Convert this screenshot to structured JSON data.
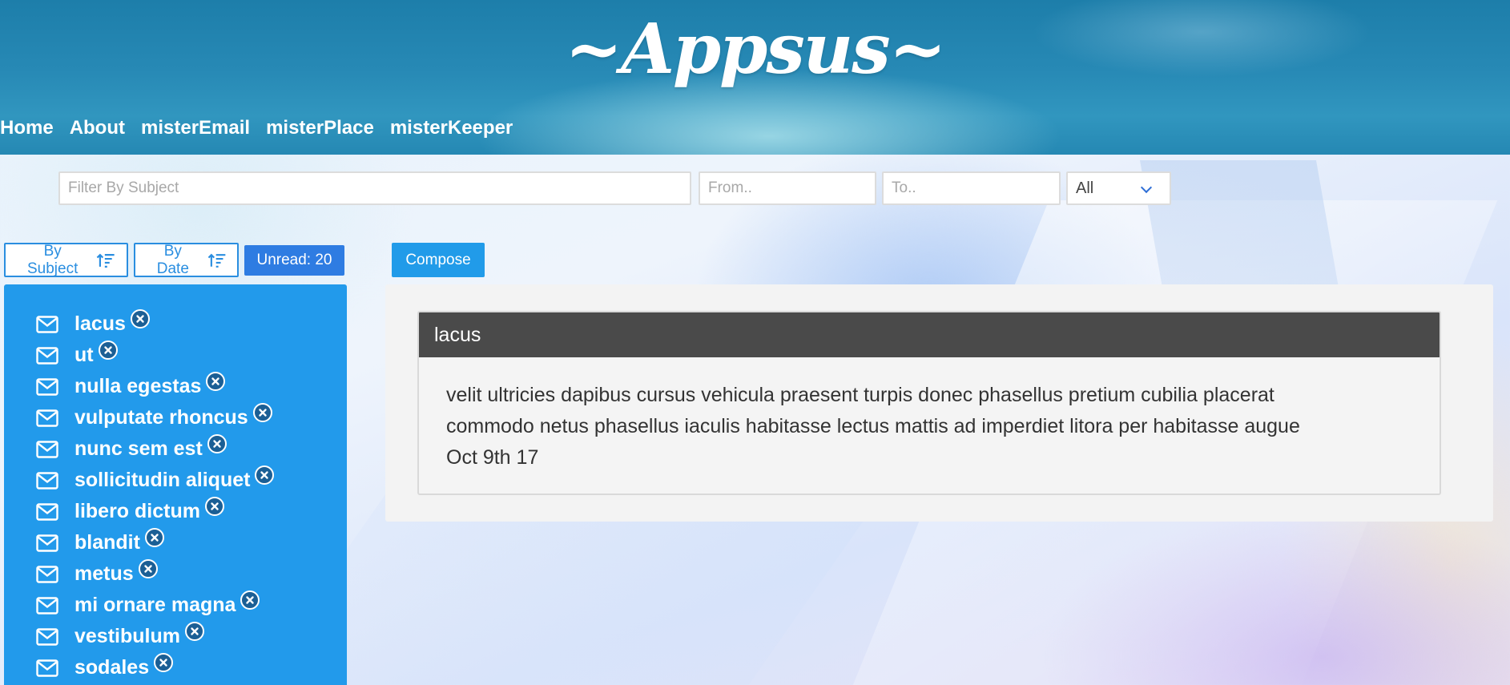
{
  "header": {
    "logo_text": "~Appsus~",
    "nav": [
      {
        "label": "Home"
      },
      {
        "label": "About"
      },
      {
        "label": "misterEmail"
      },
      {
        "label": "misterPlace"
      },
      {
        "label": "misterKeeper"
      }
    ]
  },
  "filters": {
    "subject_placeholder": "Filter By Subject",
    "from_placeholder": "From..",
    "to_placeholder": "To..",
    "status_selected": "All"
  },
  "toolbar": {
    "sort_subject_label": "By Subject",
    "sort_date_label": "By Date",
    "unread_label": "Unread: 20",
    "compose_label": "Compose"
  },
  "emails": [
    {
      "subject": "lacus"
    },
    {
      "subject": "ut"
    },
    {
      "subject": "nulla egestas"
    },
    {
      "subject": "vulputate rhoncus"
    },
    {
      "subject": "nunc sem est"
    },
    {
      "subject": "sollicitudin aliquet"
    },
    {
      "subject": "libero dictum"
    },
    {
      "subject": "blandit"
    },
    {
      "subject": "metus"
    },
    {
      "subject": "mi ornare magna"
    },
    {
      "subject": "vestibulum"
    },
    {
      "subject": "sodales"
    }
  ],
  "preview": {
    "subject": "lacus",
    "body_line1": "velit ultricies dapibus cursus vehicula praesent turpis donec phasellus pretium cubilia placerat",
    "body_line2": "commodo netus phasellus iaculis habitasse lectus mattis ad imperdiet litora per habitasse augue",
    "date": "Oct 9th 17"
  },
  "icons": {
    "email": "envelope-icon",
    "delete": "close-icon",
    "sort": "sort-ascending-icon",
    "dropdown": "chevron-down-icon"
  },
  "colors": {
    "header": "#2789b5",
    "list_bg": "#229aeb",
    "unread_badge": "#2e7ce2",
    "compose": "#219be9",
    "preview_header": "#4a4a4a"
  }
}
